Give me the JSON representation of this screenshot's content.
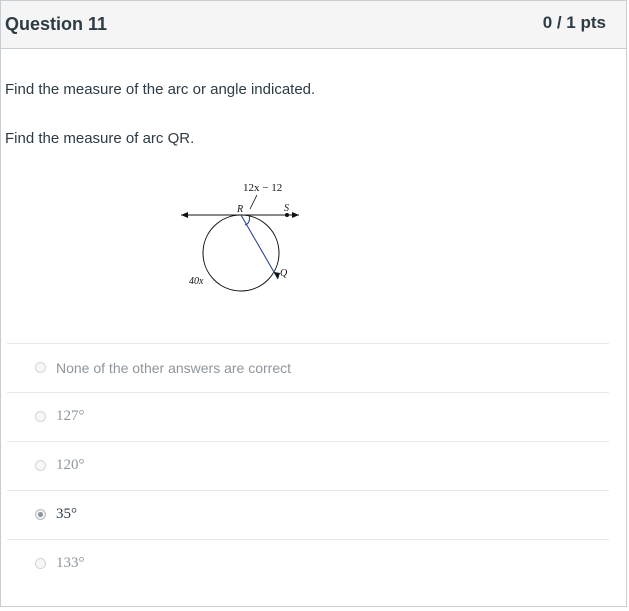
{
  "question": {
    "title": "Question 11",
    "points": "0 / 1 pts",
    "instruction": "Find the measure of the arc or angle indicated.",
    "prompt": "Find the measure of arc QR."
  },
  "figure": {
    "arc_label_top": "12x − 12",
    "arc_label_left": "40x",
    "point_r": "R",
    "point_s": "S",
    "point_q": "Q"
  },
  "answers": [
    {
      "label": "None of the other answers are correct",
      "selected": false
    },
    {
      "label": "127°",
      "selected": false
    },
    {
      "label": "120°",
      "selected": false
    },
    {
      "label": "35°",
      "selected": true
    },
    {
      "label": "133°",
      "selected": false
    }
  ]
}
